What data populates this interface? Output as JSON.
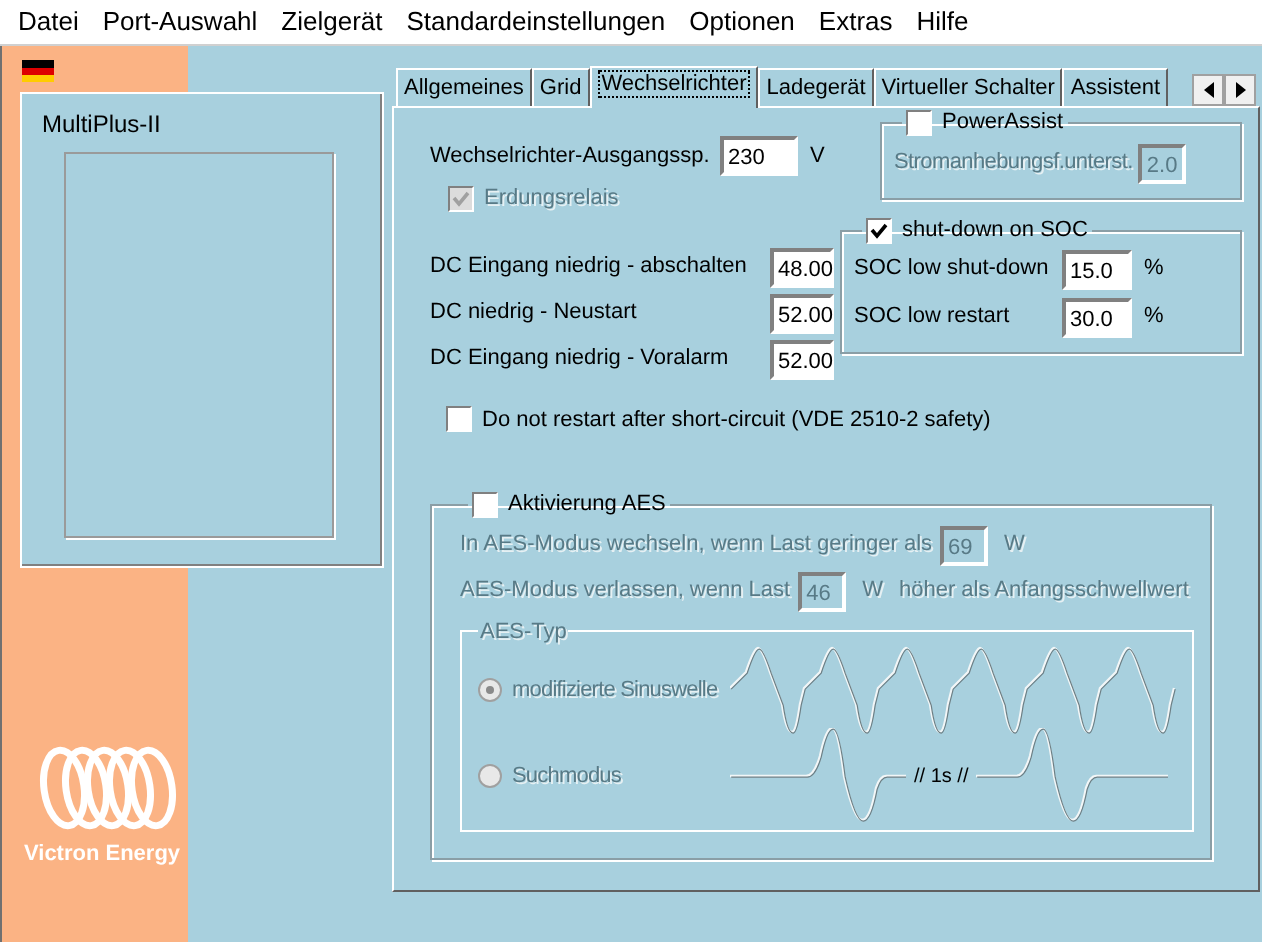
{
  "menu": [
    "Datei",
    "Port-Auswahl",
    "Zielgerät",
    "Standardeinstellungen",
    "Optionen",
    "Extras",
    "Hilfe"
  ],
  "device": {
    "title": "MultiPlus-II"
  },
  "logo": {
    "text": "Victron Energy"
  },
  "tabs": [
    {
      "label": "Allgemeines",
      "selected": false
    },
    {
      "label": "Grid",
      "selected": false
    },
    {
      "label": "Wechselrichter",
      "selected": true
    },
    {
      "label": "Ladegerät",
      "selected": false
    },
    {
      "label": "Virtueller Schalter",
      "selected": false
    },
    {
      "label": "Assistent",
      "selected": false
    }
  ],
  "inverter": {
    "output_voltage": {
      "label": "Wechselrichter-Ausgangssp.",
      "value": "230",
      "unit": "V"
    },
    "earth_relay": {
      "label": "Erdungsrelais",
      "checked": true,
      "disabled": true
    },
    "dc_fields": [
      {
        "label": "DC Eingang niedrig - abschalten",
        "value": "48.00"
      },
      {
        "label": "DC niedrig - Neustart",
        "value": "52.00"
      },
      {
        "label": "DC Eingang niedrig - Voralarm",
        "value": "52.00"
      }
    ],
    "power_assist": {
      "label": "PowerAssist",
      "checked": false,
      "factor_label": "Stromanhebungsf.unterst.",
      "factor_value": "2.0"
    },
    "soc": {
      "label": "shut-down on SOC",
      "checked": true,
      "fields": [
        {
          "label": "SOC low shut-down",
          "value": "15.0",
          "unit": "%"
        },
        {
          "label": "SOC low restart",
          "value": "30.0",
          "unit": "%"
        }
      ]
    },
    "no_restart": {
      "label": "Do not restart after short-circuit (VDE 2510-2  safety)",
      "checked": false
    },
    "aes": {
      "label": "Aktivierung AES",
      "checked": false,
      "enter": {
        "label": "In AES-Modus wechseln, wenn Last geringer als",
        "value": "69",
        "unit": "W"
      },
      "leave": {
        "label": "AES-Modus verlassen, wenn Last",
        "value": "46",
        "unit": "W",
        "after": "höher als Anfangsschwellwert"
      },
      "type": {
        "title": "AES-Typ",
        "options": [
          {
            "kind": "modified",
            "label": "modifizierte Sinuswelle",
            "selected": true
          },
          {
            "kind": "search",
            "label": "Suchmodus",
            "selected": false,
            "marker": "// 1s //"
          }
        ]
      }
    }
  }
}
